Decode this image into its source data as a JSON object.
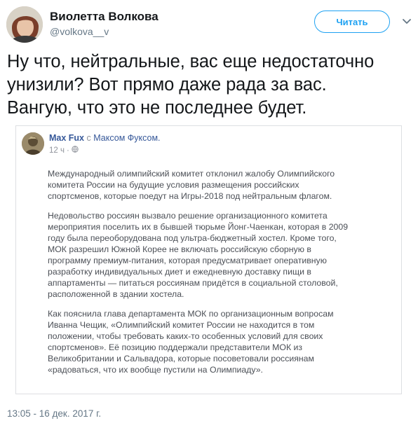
{
  "author": {
    "name": "Виолетта Волкова",
    "handle": "@volkova__v"
  },
  "follow_button": "Читать",
  "tweet_text": [
    "Ну что, нейтральные, вас еще недостаточно",
    "унизили? Вот прямо даже рада за вас.",
    "Вангую, что это не последнее будет."
  ],
  "embedded_post": {
    "author": "Max Fux",
    "with_word": "с",
    "tagged": "Максом Фуксом.",
    "time": "12 ч",
    "paragraphs": [
      [
        "Международный олимпийский комитет отклонил жалобу Олимпийского",
        "комитета России на будущие условия размещения российских",
        "спортсменов, которые поедут на Игры-2018 под нейтральным флагом."
      ],
      [
        "Недовольство россиян вызвало решение организационного комитета",
        "мероприятия поселить их в бывшей тюрьме Йонг-Чаенкан, которая в 2009",
        "году была переоборудована под ультра-бюджетный хостел. Кроме того,",
        "МОК разрешил Южной Корее не включать российскую сборную в",
        "программу премиум-питания, которая предусматривает оперативную",
        "разработку индивидуальных диет и ежедневную доставку пищи в",
        "аппартаменты — питаться россиянам придётся в социальной столовой,",
        "расположенной в здании хостела."
      ],
      [
        "Как пояснила глава департамента МОК по организационным вопросам",
        "Иванна Чещик, «Олимпийский комитет России не находится в том",
        "положении, чтобы требовать каких-то особенных условий для своих",
        "спортсменов». Её позицию поддержали представители МОК из",
        "Великобритании и Сальвадора, которые посоветовали россиянам",
        "«радоваться, что их вообще пустили на Олимпиаду»."
      ]
    ]
  },
  "timestamp": "13:05 - 16 дек. 2017 г.",
  "icons": {
    "more": "chevron-down-icon",
    "privacy": "globe-icon"
  }
}
